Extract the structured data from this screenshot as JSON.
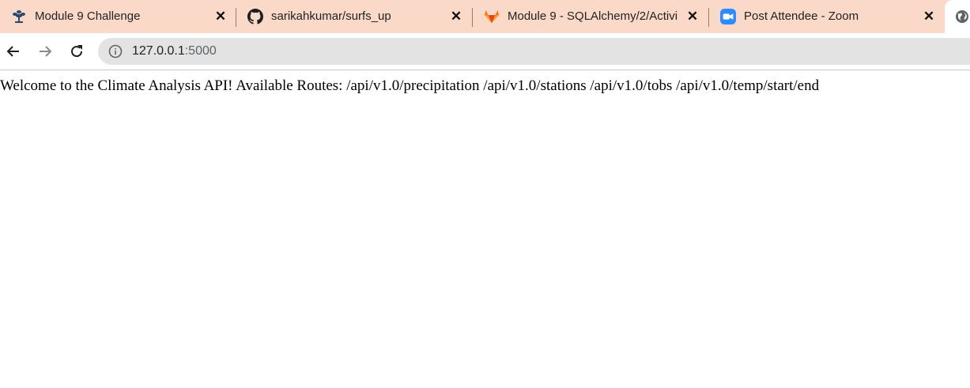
{
  "tabs": [
    {
      "title": "Module 9 Challenge",
      "icon": "bootcamp-logo-icon"
    },
    {
      "title": "sarikahkumar/surfs_up",
      "icon": "github-icon"
    },
    {
      "title": "Module 9 - SQLAlchemy/2/Activi",
      "icon": "gitlab-icon"
    },
    {
      "title": "Post Attendee - Zoom",
      "icon": "zoom-icon"
    },
    {
      "title": "",
      "icon": "globe-icon",
      "active": true
    }
  ],
  "toolbar": {
    "back_icon": "back-arrow-icon",
    "forward_icon": "forward-arrow-icon",
    "reload_icon": "reload-icon",
    "info_icon": "info-icon",
    "url_host": "127.0.0.1",
    "url_port": ":5000"
  },
  "page": {
    "text": "Welcome to the Climate Analysis API! Available Routes: /api/v1.0/precipitation /api/v1.0/stations /api/v1.0/tobs /api/v1.0/temp/start/end"
  },
  "colors": {
    "tabstrip": "#fbd9c8",
    "omnibox": "#e3e3e3",
    "zoom": "#2d8cff",
    "gitlab": "#fc6d26"
  }
}
